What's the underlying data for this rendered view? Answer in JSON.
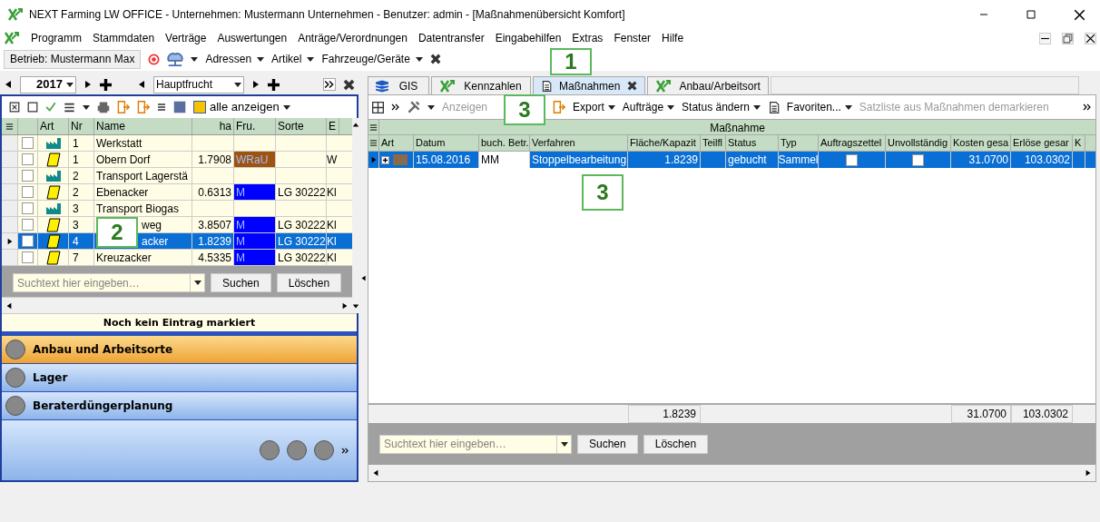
{
  "window": {
    "title": "NEXT Farming LW OFFICE - Unternehmen: Mustermann Unternehmen - Benutzer: admin - [Maßnahmenübersicht Komfort]"
  },
  "menu": [
    "Programm",
    "Stammdaten",
    "Verträge",
    "Auswertungen",
    "Anträge/Verordnungen",
    "Datentransfer",
    "Eingabehilfen",
    "Extras",
    "Fenster",
    "Hilfe"
  ],
  "toolbar": {
    "company": "Betrieb: Mustermann Max",
    "dropdowns": [
      "Adressen",
      "Artikel",
      "Fahrzeuge/Geräte"
    ]
  },
  "left": {
    "year": "2017",
    "crop": "Hauptfrucht",
    "filter": "alle anzeigen",
    "columns": [
      "Art",
      "Nr",
      "Name",
      "ha",
      "Fru.",
      "Sorte",
      "E"
    ],
    "rows": [
      {
        "kind": "facility",
        "checked": false,
        "selected": false,
        "nr": "1",
        "name": "Werkstatt",
        "ha": "",
        "fru": "",
        "sorte": "",
        "e": ""
      },
      {
        "kind": "field",
        "checked": false,
        "selected": false,
        "nr": "1",
        "name": "Obern Dorf",
        "ha": "1.7908",
        "fru": "WRaU",
        "color": "#a0520f",
        "sorte": "",
        "e": "W"
      },
      {
        "kind": "facility",
        "checked": false,
        "selected": false,
        "nr": "2",
        "name": "Transport Lagerstä",
        "ha": "",
        "fru": "",
        "sorte": "",
        "e": ""
      },
      {
        "kind": "field",
        "checked": false,
        "selected": false,
        "nr": "2",
        "name": "Ebenacker",
        "ha": "0.6313",
        "fru": "M",
        "color": "#0000ff",
        "sorte": "LG 30222",
        "e": "Kl"
      },
      {
        "kind": "facility",
        "checked": false,
        "selected": false,
        "nr": "3",
        "name": "Transport Biogas",
        "ha": "",
        "fru": "",
        "sorte": "",
        "e": ""
      },
      {
        "kind": "field",
        "checked": false,
        "selected": false,
        "nr": "3",
        "name": "weg",
        "ha": "3.8507",
        "fru": "M",
        "color": "#0000ff",
        "sorte": "LG 30222",
        "e": "Kl"
      },
      {
        "kind": "field",
        "checked": false,
        "selected": true,
        "nr": "4",
        "name": "acker",
        "ha": "1.8239",
        "fru": "M",
        "color": "#0000ff",
        "sorte": "LG 30222",
        "e": "Kl"
      },
      {
        "kind": "field",
        "checked": false,
        "selected": false,
        "nr": "7",
        "name": "Kreuzacker",
        "ha": "4.5335",
        "fru": "M",
        "color": "#0000ff",
        "sorte": "LG 30222",
        "e": "Kl"
      }
    ],
    "search": {
      "placeholder": "Suchtext hier eingeben…"
    },
    "buttons": [
      "Suchen",
      "Löschen"
    ],
    "status": "Noch kein Eintrag markiert",
    "sections": [
      {
        "label": "Anbau und Arbeitsorte",
        "selected": true
      },
      {
        "label": "Lager",
        "selected": false
      },
      {
        "label": "Beraterdüngerplanung",
        "selected": false
      }
    ]
  },
  "right": {
    "tabs": [
      {
        "label": "GIS",
        "selected": false,
        "closable": false
      },
      {
        "label": "Kennzahlen",
        "selected": false,
        "closable": false
      },
      {
        "label": "Maßnahmen",
        "selected": true,
        "closable": true
      },
      {
        "label": "Anbau/Arbeitsort",
        "selected": false,
        "closable": false
      }
    ],
    "toolbar": [
      {
        "label": "Anzeigen",
        "disabled": true
      },
      {
        "label": "Export",
        "disabled": false
      },
      {
        "label": "Aufträge",
        "disabled": false
      },
      {
        "label": "Status ändern",
        "disabled": false
      },
      {
        "label": "Favoriten...",
        "disabled": false
      },
      {
        "label": "Satzliste aus Maßnahmen demarkieren",
        "disabled": true
      }
    ],
    "group": "Maßnahme",
    "columns": [
      "Art",
      "Datum",
      "buch. Betr.",
      "Verfahren",
      "Fläche/Kapazit",
      "Teilfl",
      "Status",
      "Typ",
      "Auftragszettel",
      "Unvollständig",
      "Kosten gesa",
      "Erlöse gesar",
      "K"
    ],
    "rows": [
      {
        "selected": true,
        "datum": "15.08.2016",
        "betr": "MM",
        "verfahren": "Stoppelbearbeitung",
        "flaeche": "1.8239",
        "status": "gebucht",
        "typ": "Sammel",
        "auftrag": false,
        "unvollstaendig": false,
        "kosten": "31.0700",
        "erloese": "103.0302"
      }
    ],
    "totals": {
      "flaeche": "1.8239",
      "kosten": "31.0700",
      "erloese": "103.0302"
    },
    "search": {
      "placeholder": "Suchtext hier eingeben…"
    },
    "buttons": [
      "Suchen",
      "Löschen"
    ]
  },
  "callouts": [
    "1",
    "2",
    "3",
    "3"
  ]
}
